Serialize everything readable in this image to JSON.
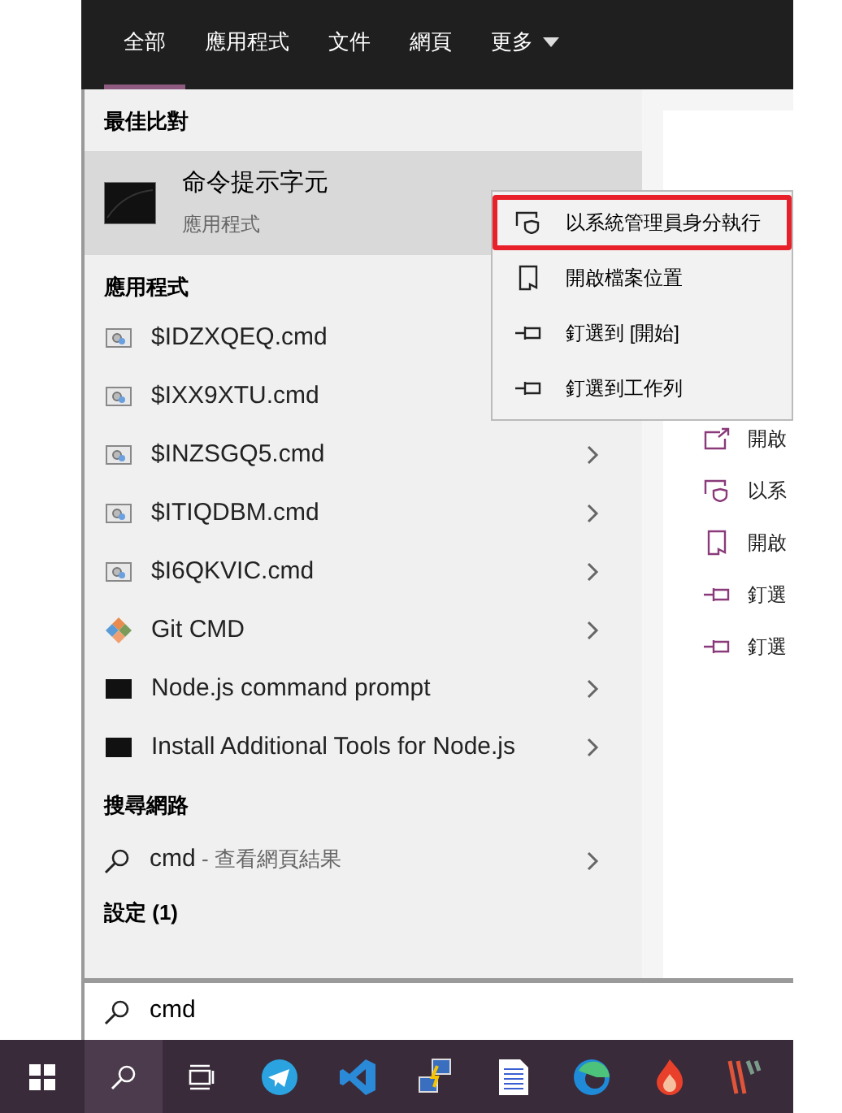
{
  "tabs": [
    {
      "label": "全部",
      "selected": true
    },
    {
      "label": "應用程式",
      "selected": false
    },
    {
      "label": "文件",
      "selected": false
    },
    {
      "label": "網頁",
      "selected": false
    },
    {
      "label": "更多",
      "selected": false,
      "dropdown": true
    }
  ],
  "best_match": {
    "heading": "最佳比對",
    "item": {
      "title": "命令提示字元",
      "subtitle": "應用程式",
      "selected": true
    }
  },
  "apps": {
    "heading": "應用程式",
    "items": [
      {
        "name": "$IDZXQEQ.cmd",
        "kind": "script"
      },
      {
        "name": "$IXX9XTU.cmd",
        "kind": "script"
      },
      {
        "name": "$INZSGQ5.cmd",
        "kind": "script",
        "arrow": true
      },
      {
        "name": "$ITIQDBM.cmd",
        "kind": "script",
        "arrow": true
      },
      {
        "name": "$I6QKVIC.cmd",
        "kind": "script",
        "arrow": true
      },
      {
        "name": "Git CMD",
        "kind": "git",
        "arrow": true
      },
      {
        "name": "Node.js command prompt",
        "kind": "console",
        "arrow": true
      },
      {
        "name": "Install Additional Tools for Node.js",
        "kind": "console",
        "arrow": true
      }
    ]
  },
  "web": {
    "heading": "搜尋網路",
    "query": "cmd",
    "suffix": " - 查看網頁結果"
  },
  "settings": {
    "heading": "設定 (1)"
  },
  "preview_actions": [
    {
      "label": "開啟",
      "kind": "open"
    },
    {
      "label": "以系",
      "kind": "admin"
    },
    {
      "label": "開啟",
      "kind": "folder"
    },
    {
      "label": "釘選",
      "kind": "pin"
    },
    {
      "label": "釘選",
      "kind": "pin"
    }
  ],
  "context_menu": [
    {
      "label": "以系統管理員身分執行",
      "kind": "admin",
      "selected": true
    },
    {
      "label": "開啟檔案位置",
      "kind": "folder",
      "selected": false
    },
    {
      "label": "釘選到 [開始]",
      "kind": "pin",
      "selected": false
    },
    {
      "label": "釘選到工作列",
      "kind": "pin",
      "selected": false
    }
  ],
  "search": {
    "value": "cmd"
  }
}
